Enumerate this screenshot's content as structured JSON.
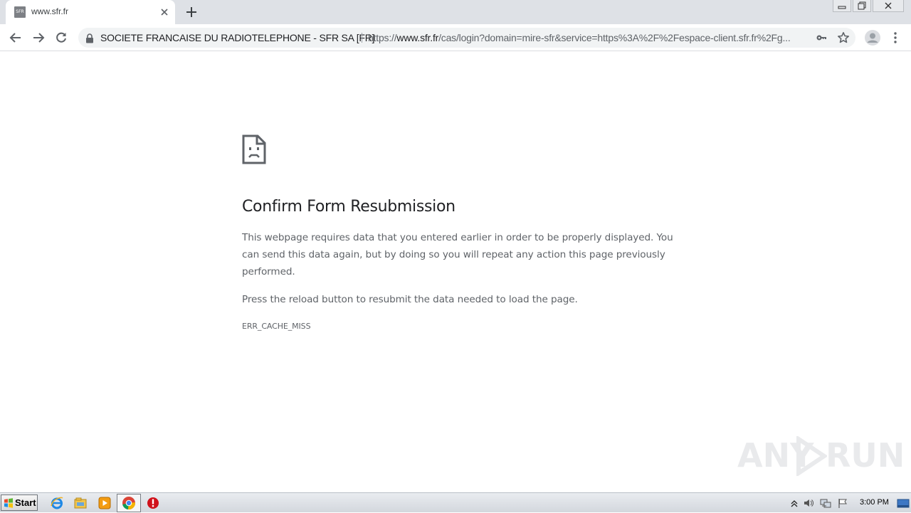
{
  "window": {
    "tab_title": "www.sfr.fr",
    "favicon_text": "SFR"
  },
  "toolbar": {
    "cert_label": "SOCIETE FRANCAISE DU RADIOTELEPHONE - SFR SA [FR]",
    "url_scheme": "https://",
    "url_host": "www.sfr.fr",
    "url_path": "/cas/login?domain=mire-sfr&service=https%3A%2F%2Fespace-client.sfr.fr%2Fg..."
  },
  "error": {
    "title": "Confirm Form Resubmission",
    "paragraph1": "This webpage requires data that you entered earlier in order to be properly displayed. You can send this data again, but by doing so you will repeat any action this page previously performed.",
    "paragraph2": "Press the reload button to resubmit the data needed to load the page.",
    "code": "ERR_CACHE_MISS"
  },
  "watermark": {
    "left": "ANY",
    "right": "RUN"
  },
  "taskbar": {
    "start_label": "Start",
    "clock": "3:00 PM"
  },
  "colors": {
    "tabstrip": "#dee1e6",
    "omnibox": "#f1f3f4",
    "title_text": "#202124",
    "body_text": "#5f6368"
  },
  "icons": [
    "back-icon",
    "forward-icon",
    "reload-icon",
    "lock-icon",
    "key-icon",
    "star-icon",
    "profile-icon",
    "menu-icon",
    "sad-page-icon",
    "ie-icon",
    "explorer-icon",
    "media-player-icon",
    "chrome-icon",
    "stop-icon"
  ]
}
